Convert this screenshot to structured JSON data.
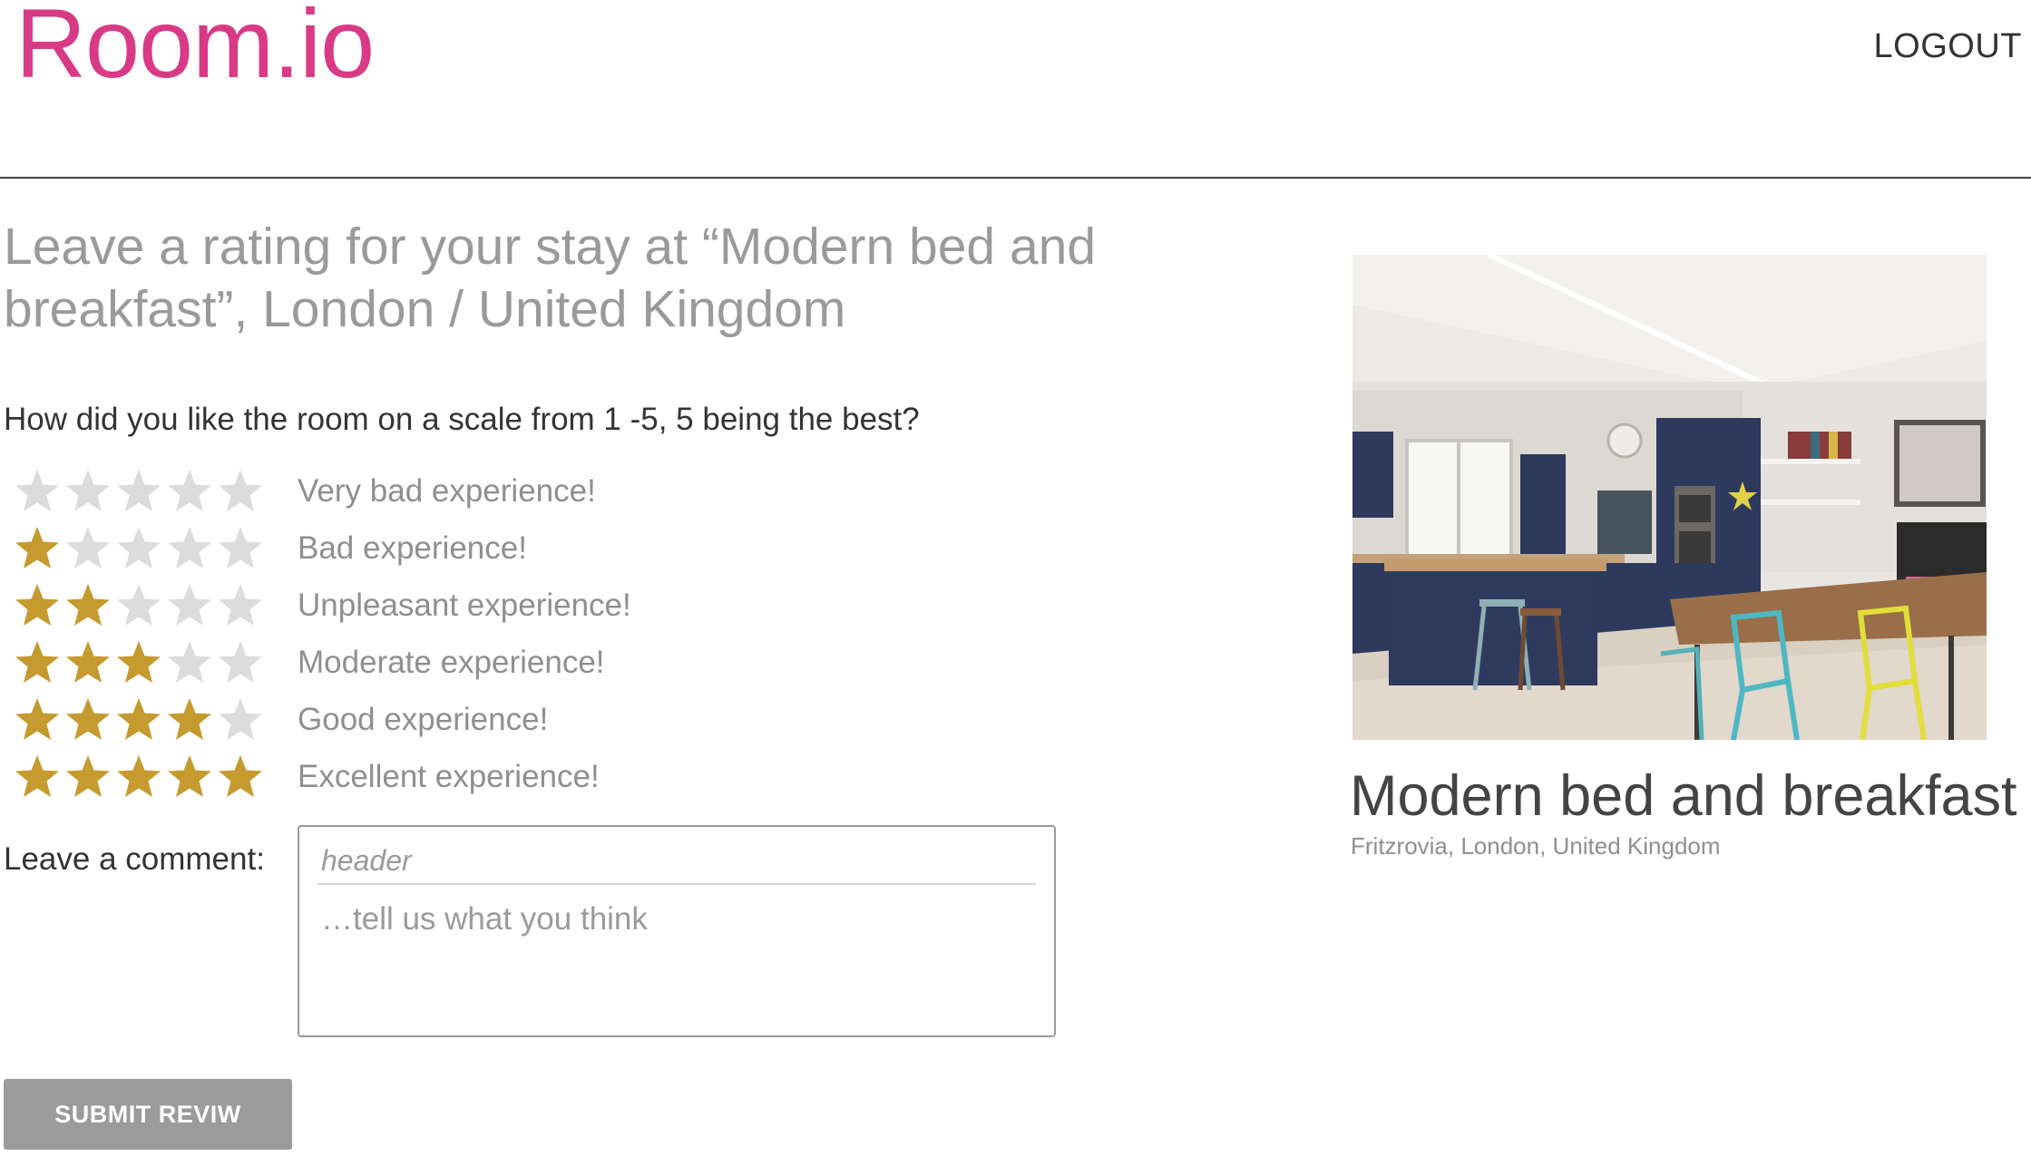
{
  "header": {
    "logo_main": "Room.",
    "logo_suffix": "io",
    "logout_label": "LOGOUT"
  },
  "colors": {
    "brand": "#d93a86",
    "star_filled": "#c59a2f",
    "star_empty": "#dcdcdc",
    "button_bg": "#9b9b9b"
  },
  "review": {
    "title": "Leave a rating for your stay at “Modern bed and breakfast”, London / United Kingdom",
    "question": "How did you like the room on a scale from 1 -5, 5 being the best?",
    "rating_options": [
      {
        "filled": 0,
        "label": "Very bad experience!"
      },
      {
        "filled": 1,
        "label": "Bad experience!"
      },
      {
        "filled": 2,
        "label": "Unpleasant experience!"
      },
      {
        "filled": 3,
        "label": "Moderate experience!"
      },
      {
        "filled": 4,
        "label": "Good experience!"
      },
      {
        "filled": 5,
        "label": "Excellent experience!"
      }
    ],
    "comment_label": "Leave a comment:",
    "comment_header_placeholder": "header",
    "comment_body_placeholder": "…tell us what you think",
    "submit_label": "SUBMIT REVIW"
  },
  "room": {
    "name": "Modern bed and breakfast",
    "location": "Fritzrovia, London, United Kingdom",
    "photo_icon": "kitchen-photo"
  }
}
